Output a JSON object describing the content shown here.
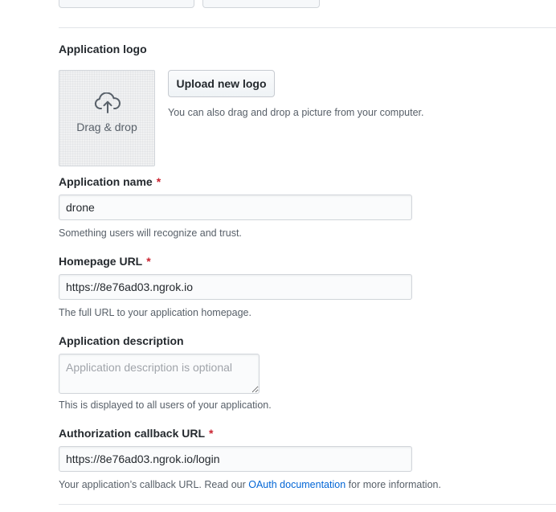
{
  "logo_section": {
    "label": "Application logo",
    "dropzone_text": "Drag & drop",
    "upload_button": "Upload new logo",
    "upload_hint": "You can also drag and drop a picture from your computer."
  },
  "fields": {
    "app_name": {
      "label": "Application name",
      "required_mark": "*",
      "value": "drone",
      "note": "Something users will recognize and trust."
    },
    "homepage_url": {
      "label": "Homepage URL",
      "required_mark": "*",
      "value": "https://8e76ad03.ngrok.io",
      "note": "The full URL to your application homepage."
    },
    "description": {
      "label": "Application description",
      "placeholder": "Application description is optional",
      "note": "This is displayed to all users of your application."
    },
    "callback_url": {
      "label": "Authorization callback URL",
      "required_mark": "*",
      "value": "https://8e76ad03.ngrok.io/login",
      "note_before": "Your application’s callback URL. Read our ",
      "note_link": "OAuth documentation",
      "note_after": " for more information."
    }
  },
  "colors": {
    "required": "#cb2431",
    "link": "#0366d6",
    "muted_text": "#586069"
  },
  "icons": {
    "dropzone_icon": "cloud-upload-icon"
  }
}
